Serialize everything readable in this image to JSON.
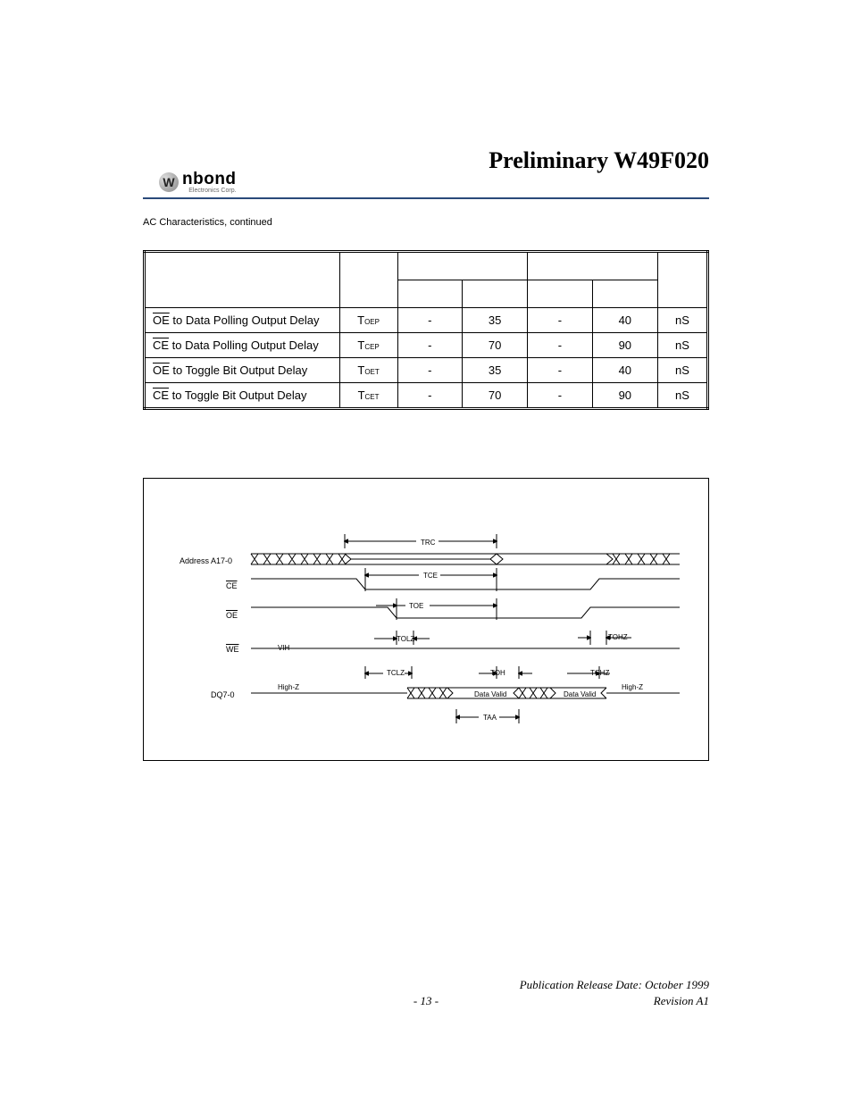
{
  "header": {
    "title": "Preliminary W49F020",
    "logo_name": "nbond",
    "logo_sub": "Electronics Corp."
  },
  "section": {
    "subtitle": "AC Characteristics, continued"
  },
  "table": {
    "rows": [
      {
        "param_pin": "OE",
        "param_rest": " to Data Polling Output Delay",
        "sym_pre": "T",
        "sym_sub": "OEP",
        "min1": "-",
        "max1": "35",
        "min2": "-",
        "max2": "40",
        "unit": "nS"
      },
      {
        "param_pin": "CE",
        "param_rest": " to Data Polling Output Delay",
        "sym_pre": "T",
        "sym_sub": "CEP",
        "min1": "-",
        "max1": "70",
        "min2": "-",
        "max2": "90",
        "unit": "nS"
      },
      {
        "param_pin": "OE",
        "param_rest": " to Toggle Bit Output Delay",
        "sym_pre": "T",
        "sym_sub": "OET",
        "min1": "-",
        "max1": "35",
        "min2": "-",
        "max2": "40",
        "unit": "nS"
      },
      {
        "param_pin": "CE",
        "param_rest": " to Toggle Bit Output Delay",
        "sym_pre": "T",
        "sym_sub": "CET",
        "min1": "-",
        "max1": "70",
        "min2": "-",
        "max2": "90",
        "unit": "nS"
      }
    ]
  },
  "timing": {
    "signals": {
      "addr": "Address A17-0",
      "ce": "CE",
      "oe": "OE",
      "we": "WE",
      "dq": "DQ7-0"
    },
    "params": {
      "trc": "TRC",
      "tce": "TCE",
      "toe": "TOE",
      "tolz": "TOLZ",
      "tohz": "TOHZ",
      "tclz": "TCLZ",
      "tchz": "TCHZ",
      "toh": "TOH",
      "taa": "TAA"
    },
    "labels": {
      "vih": "VIH",
      "highz": "High-Z",
      "data_valid": "Data Valid"
    }
  },
  "footer": {
    "publication": "Publication Release Date: October 1999",
    "page": "- 13 -",
    "revision": "Revision A1"
  }
}
